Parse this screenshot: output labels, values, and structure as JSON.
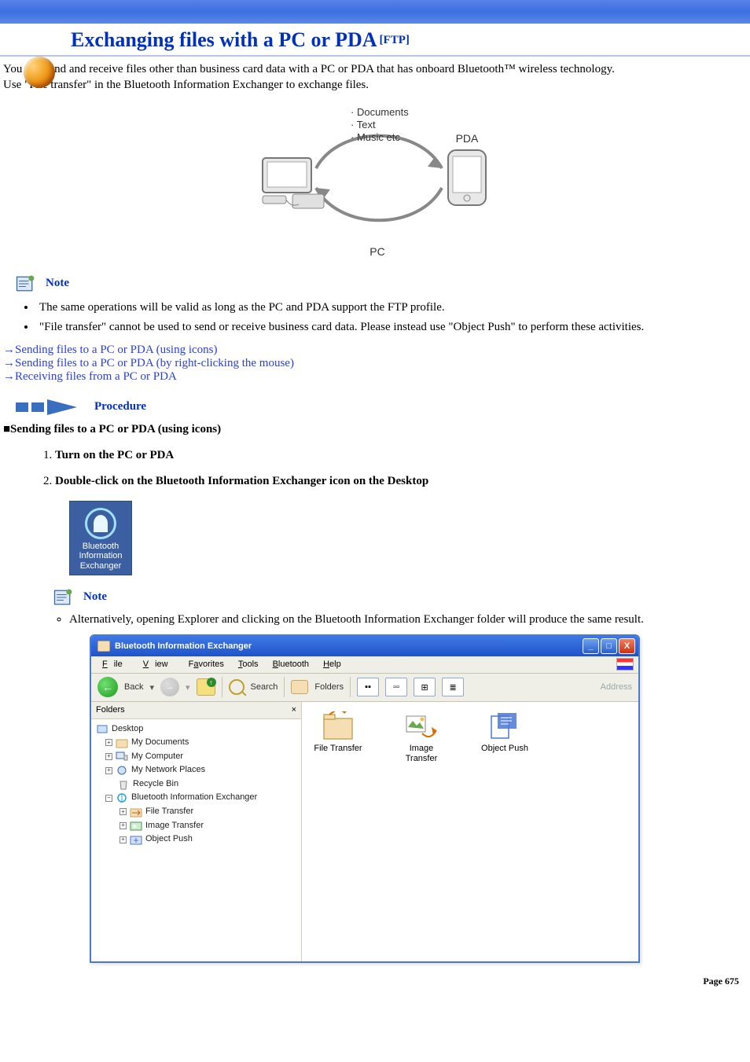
{
  "page": {
    "title": "Exchanging files with a PC or PDA",
    "title_tag": "[FTP]",
    "intro1": "You can send and receive files other than business card data with a PC or PDA that has onboard Bluetooth™ wireless technology.",
    "intro2": "Use \"File transfer\" in the Bluetooth Information Exchanger to exchange files.",
    "footer": "Page 675"
  },
  "diagram": {
    "bullets": [
      "Documents",
      "Text",
      "Music etc"
    ],
    "pda": "PDA",
    "pc": "PC"
  },
  "note": {
    "label": "Note",
    "items": [
      "The same operations will be valid as long as the PC and PDA support the FTP profile.",
      "\"File transfer\" cannot be used to send or receive business card data. Please instead use \"Object Push\" to perform these activities."
    ]
  },
  "links": {
    "arrow": "→",
    "items": [
      "Sending files to a PC or PDA (using icons)",
      "Sending files to a PC or PDA (by right-clicking the mouse)",
      "Receiving files from a PC or PDA"
    ]
  },
  "procedure": {
    "label": "Procedure"
  },
  "section1": {
    "heading": "■Sending files to a PC or PDA (using icons)",
    "step1": "Turn on the PC or PDA",
    "step2": "Double-click on the Bluetooth Information Exchanger icon on the Desktop"
  },
  "bix_tile": {
    "l1": "Bluetooth",
    "l2": "Information",
    "l3": "Exchanger"
  },
  "note2": {
    "label": "Note",
    "item": "Alternatively, opening Explorer and clicking on the Bluetooth Information Exchanger folder will produce the same result."
  },
  "win": {
    "title": "Bluetooth Information Exchanger",
    "buttons": {
      "min": "_",
      "max": "□",
      "close": "X"
    },
    "menu": {
      "file": "File",
      "view": "View",
      "favorites": "Favorites",
      "tools": "Tools",
      "bluetooth": "Bluetooth",
      "help": "Help"
    },
    "toolbar": {
      "back": "Back",
      "search": "Search",
      "folders": "Folders",
      "address": "Address"
    },
    "folders_pane": {
      "header": "Folders",
      "close": "×",
      "tree": {
        "desktop": "Desktop",
        "mydocs": "My Documents",
        "mycomp": "My Computer",
        "myplaces": "My Network Places",
        "recycle": "Recycle Bin",
        "bix": "Bluetooth Information Exchanger",
        "ft": "File Transfer",
        "it": "Image Transfer",
        "op": "Object Push"
      }
    },
    "content": {
      "file_transfer": "File Transfer",
      "image_transfer": "Image Transfer",
      "object_push": "Object Push"
    }
  }
}
